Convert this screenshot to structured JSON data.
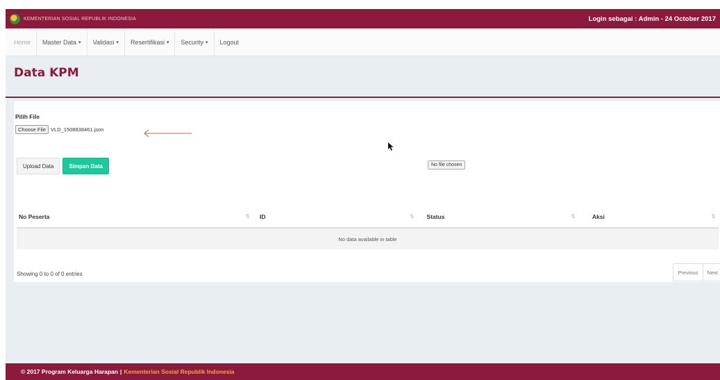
{
  "app": {
    "brand_text": "KEMENTERIAN SOSIAL REPUBLIK INDONESIA",
    "login_info": "Login sebagai : Admin - 24 October 2017"
  },
  "nav": {
    "items": [
      {
        "label": "Home",
        "dropdown": false
      },
      {
        "label": "Master Data",
        "dropdown": true
      },
      {
        "label": "Validasi",
        "dropdown": true
      },
      {
        "label": "Resertifikasi",
        "dropdown": true
      },
      {
        "label": "Security",
        "dropdown": true
      },
      {
        "label": "Logout",
        "dropdown": false
      }
    ],
    "caret": "▾"
  },
  "page": {
    "title": "Data KPM"
  },
  "form": {
    "file_label": "Pilih File",
    "choose_button": "Choose File",
    "file_name": "VLD_1508838461.json",
    "upload_button": "Upload Data",
    "simpan_button": "Simpan Data",
    "no_file_label": "No file chosen"
  },
  "table": {
    "columns": [
      "No Peserta",
      "ID",
      "Status",
      "Aksi"
    ],
    "sort_icon": "⇅",
    "empty_message": "No data available in table",
    "showing": "Showing 0 to 0 of 0 entries",
    "prev": "Previous",
    "next": "Next"
  },
  "footer": {
    "copyright": "© 2017 Program Keluarga Harapan",
    "separator": "|",
    "link": "Kementerian Sosial Republik Indonesia"
  },
  "colors": {
    "primary": "#8c1a3c",
    "accent": "#1fc79f",
    "footer_link": "#f3a73a"
  }
}
